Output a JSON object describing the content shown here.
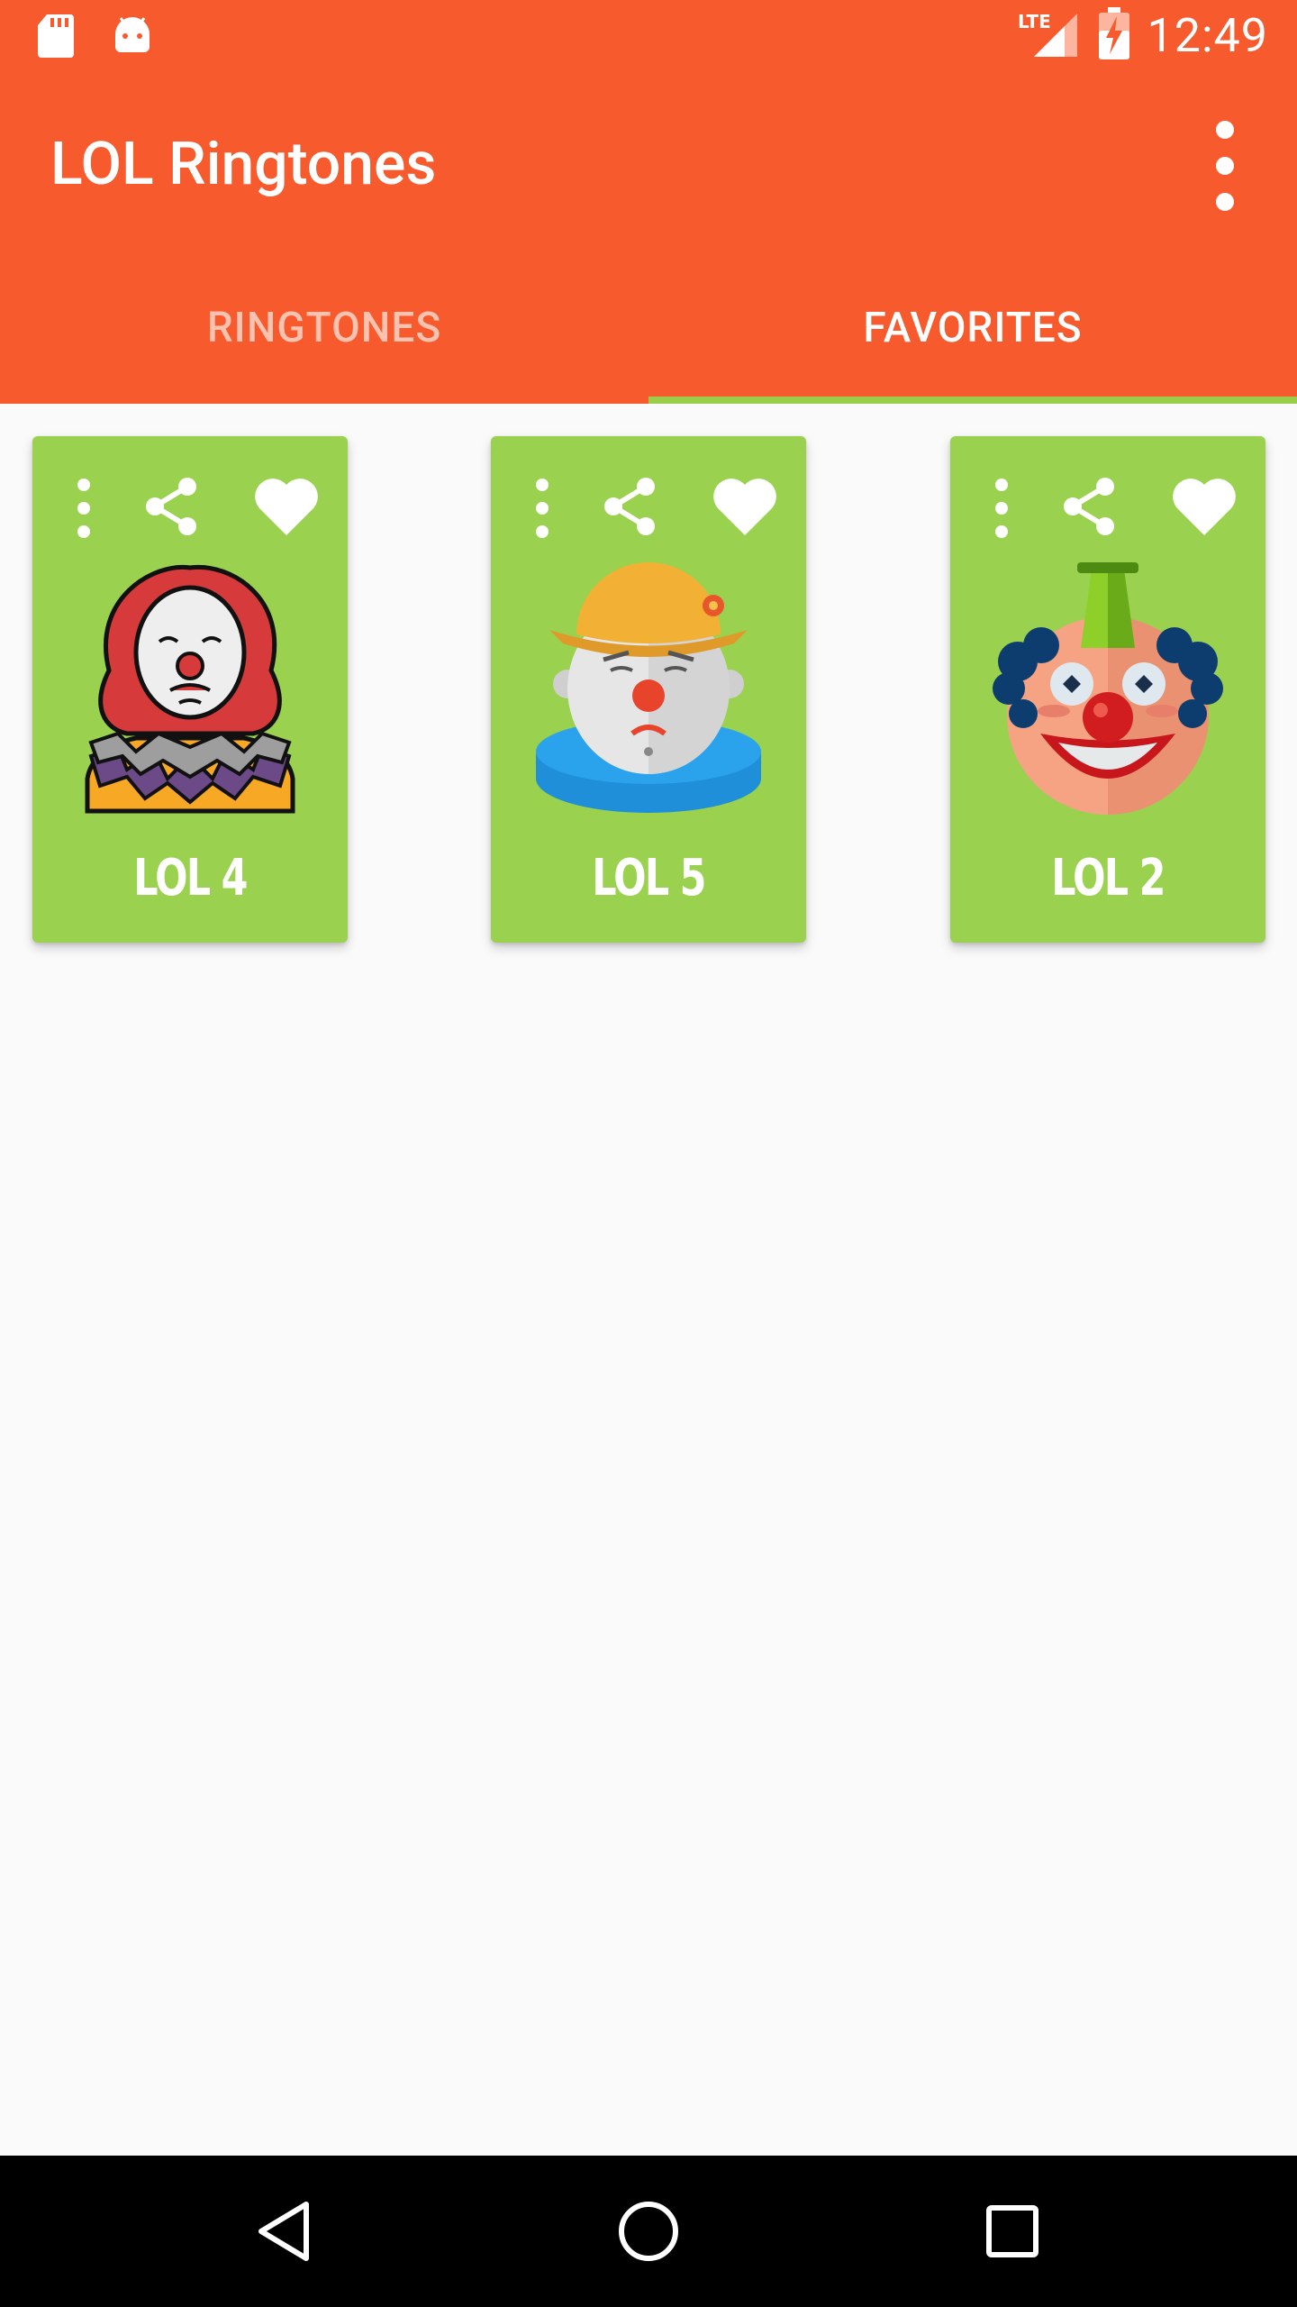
{
  "status_bar": {
    "time": "12:49",
    "left_icons": [
      "sd-card-icon",
      "android-icon"
    ],
    "right_icons": [
      "lte-signal-icon",
      "battery-charging-icon"
    ],
    "lte_label": "LTE"
  },
  "toolbar": {
    "title": "LOL Ringtones",
    "overflow_icon": "more-vert-icon"
  },
  "tabs": [
    {
      "label": "RINGTONES",
      "active": false
    },
    {
      "label": "FAVORITES",
      "active": true
    }
  ],
  "cards": [
    {
      "title": "LOL 4",
      "art": "pennywise-clown-icon"
    },
    {
      "title": "LOL 5",
      "art": "sad-clown-icon"
    },
    {
      "title": "LOL 2",
      "art": "happy-clown-icon"
    }
  ],
  "colors": {
    "primary": "#f75a2d",
    "tab_indicator": "#9acd4a",
    "card_bg": "#9ad14f",
    "background": "#fafafa",
    "nav_bar": "#000000"
  },
  "nav": {
    "back_icon": "back-icon",
    "home_icon": "home-icon",
    "recents_icon": "recents-icon"
  }
}
